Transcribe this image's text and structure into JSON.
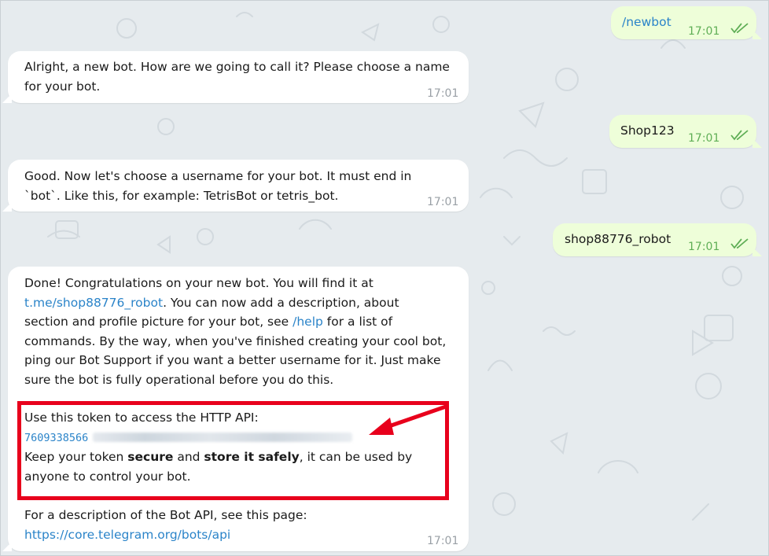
{
  "colors": {
    "background": "#e6ebee",
    "incoming_bubble": "#ffffff",
    "outgoing_bubble": "#eefed9",
    "link": "#2b84c9",
    "outgoing_time": "#5fae56",
    "highlight": "#e8001c"
  },
  "messages": [
    {
      "direction": "out",
      "text": "/newbot",
      "time": "17:01"
    },
    {
      "direction": "in",
      "line1": "Alright, a new bot. How are we going to call it? Please choose a name",
      "line2": "for your bot.",
      "time": "17:01"
    },
    {
      "direction": "out",
      "text": "Shop123",
      "time": "17:01"
    },
    {
      "direction": "in",
      "line1": "Good. Now let's choose a username for your bot. It must end in",
      "line2": "`bot`. Like this, for example: TetrisBot or tetris_bot.",
      "time": "17:01"
    },
    {
      "direction": "out",
      "text": "shop88776_robot",
      "time": "17:01"
    },
    {
      "direction": "in",
      "l1": "Done! Congratulations on your new bot. You will find it at",
      "l2_link": "t.me/shop88776_robot",
      "l2_rest": ". You can now add a description, about",
      "l3_a": "section and profile picture for your bot, see ",
      "l3_link": "/help",
      "l3_b": " for a list of",
      "l4": "commands. By the way, when you've finished creating your cool bot,",
      "l5": "ping our Bot Support if you want a better username for it. Just make",
      "l6": "sure the bot is fully operational before you do this.",
      "token_intro": "Use this token to access the HTTP API:",
      "token_prefix": "7609338566",
      "keep_a": "Keep your token ",
      "keep_bold1": "secure",
      "keep_b": " and ",
      "keep_bold2": "store it safely",
      "keep_c": ", it can be used by",
      "keep_d": "anyone to control your bot.",
      "desc": "For a description of the Bot API, see this page:",
      "desc_link": "https://core.telegram.org/bots/api",
      "time": "17:01"
    }
  ]
}
